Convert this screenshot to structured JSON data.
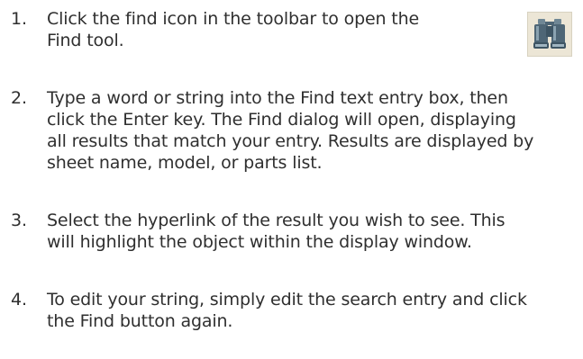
{
  "steps": [
    {
      "number": "1.",
      "lines": [
        "Click the find icon in the toolbar to open the",
        "Find tool."
      ],
      "icon": "binoculars-icon"
    },
    {
      "number": "2.",
      "lines": [
        "Type a word or string into the Find text entry box, then",
        "click the Enter key. The Find dialog will open, displaying",
        "all results that match your entry. Results are displayed by",
        "sheet name, model, or parts list."
      ]
    },
    {
      "number": "3.",
      "lines": [
        "Select the hyperlink of the result you wish to see. This",
        "will highlight the object within the display window."
      ]
    },
    {
      "number": "4.",
      "lines": [
        "To edit your string, simply edit the search entry and click",
        "the Find button again."
      ]
    }
  ],
  "colors": {
    "text": "#2f2f2f",
    "icon_background": "#ece6d6",
    "binoculars": "#4e6676"
  }
}
